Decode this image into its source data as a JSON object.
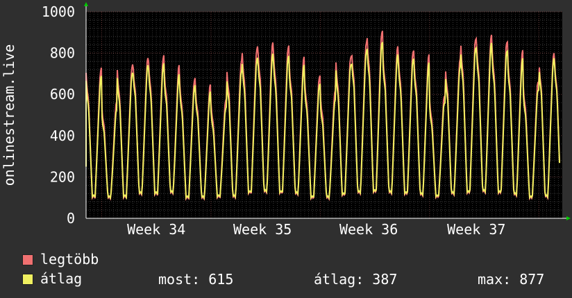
{
  "chart_data": {
    "type": "line",
    "ylabel": "onlinestream.live",
    "ylim": [
      0,
      1000
    ],
    "yticks": [
      0,
      200,
      400,
      600,
      800,
      1000
    ],
    "xtick_labels": [
      "Week 34",
      "Week 35",
      "Week 36",
      "Week 37"
    ],
    "grid": true,
    "legend_position": "bottom",
    "series": [
      {
        "name": "legtöbb",
        "color": "#f07070",
        "daily_peaks": [
          730,
          570,
          745,
          785,
          790,
          750,
          680,
          655,
          580,
          770,
          835,
          860,
          840,
          790,
          695,
          625,
          790,
          860,
          915,
          840,
          820,
          800,
          600,
          780,
          880,
          895,
          865,
          820,
          670,
          805
        ]
      },
      {
        "name": "átlag",
        "color": "#f0f060",
        "daily_peaks": [
          690,
          530,
          705,
          750,
          750,
          705,
          645,
          620,
          540,
          720,
          780,
          805,
          790,
          750,
          655,
          580,
          750,
          815,
          860,
          800,
          780,
          760,
          565,
          740,
          835,
          855,
          820,
          780,
          630,
          780
        ]
      }
    ],
    "daily_troughs": [
      100,
      95,
      100,
      115,
      115,
      120,
      95,
      95,
      100,
      100,
      120,
      125,
      120,
      115,
      95,
      95,
      110,
      120,
      125,
      120,
      115,
      110,
      100,
      115,
      120,
      125,
      120,
      110,
      95,
      100
    ]
  },
  "legend": {
    "max_label": "legtöbb",
    "avg_label": "átlag",
    "now_stat": "most: 615",
    "avg_stat": "átlag: 387",
    "max_stat": "max: 877"
  }
}
